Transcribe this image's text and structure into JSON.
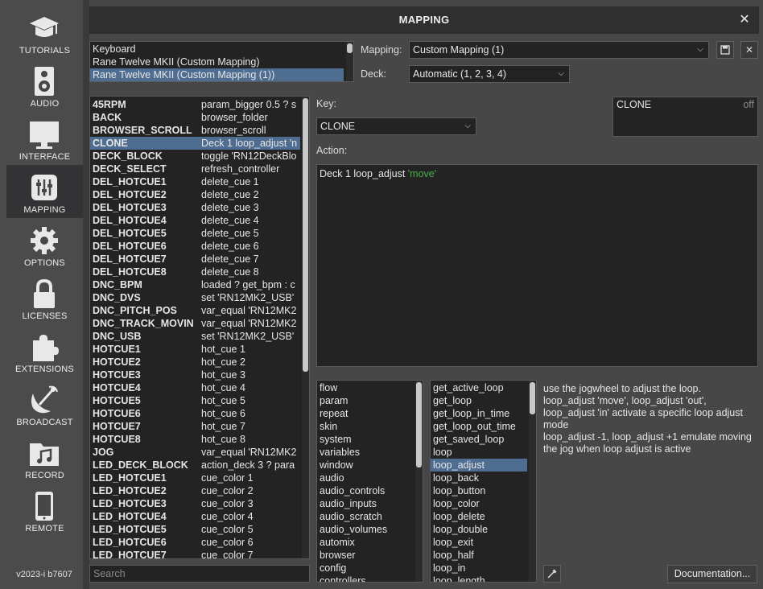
{
  "sidebar": {
    "items": [
      {
        "label": "TUTORIALS",
        "icon": "graduation-cap-icon"
      },
      {
        "label": "AUDIO",
        "icon": "speaker-icon"
      },
      {
        "label": "INTERFACE",
        "icon": "monitor-icon"
      },
      {
        "label": "MAPPING",
        "icon": "sliders-icon",
        "active": true
      },
      {
        "label": "OPTIONS",
        "icon": "gear-icon"
      },
      {
        "label": "LICENSES",
        "icon": "lock-icon"
      },
      {
        "label": "EXTENSIONS",
        "icon": "puzzle-icon"
      },
      {
        "label": "BROADCAST",
        "icon": "satellite-dish-icon"
      },
      {
        "label": "RECORD",
        "icon": "music-folder-icon"
      },
      {
        "label": "REMOTE",
        "icon": "phone-icon"
      }
    ],
    "version": "v2023-i b7607"
  },
  "window": {
    "title": "MAPPING",
    "close": "✕"
  },
  "controllers": {
    "items": [
      "Keyboard",
      "Rane Twelve MKII (Custom Mapping)",
      "Rane Twelve MKII (Custom Mapping (1))"
    ],
    "selected_index": 2
  },
  "mapping": {
    "label": "Mapping:",
    "value": "Custom Mapping (1)"
  },
  "deck": {
    "label": "Deck:",
    "value": "Automatic (1, 2, 3, 4)"
  },
  "key": {
    "label": "Key:",
    "value": "CLONE"
  },
  "action": {
    "label": "Action:",
    "text": "Deck 1 loop_adjust ",
    "arg": "'move'"
  },
  "clone_box": {
    "name": "CLONE",
    "state": "off"
  },
  "map_table": {
    "selected_index": 3,
    "rows": [
      [
        "45RPM",
        "param_bigger 0.5 ? s"
      ],
      [
        "BACK",
        "browser_folder"
      ],
      [
        "BROWSER_SCROLL",
        "browser_scroll"
      ],
      [
        "CLONE",
        "Deck 1 loop_adjust 'n"
      ],
      [
        "DECK_BLOCK",
        "toggle 'RN12DeckBlo"
      ],
      [
        "DECK_SELECT",
        "refresh_controller"
      ],
      [
        "DEL_HOTCUE1",
        "delete_cue 1"
      ],
      [
        "DEL_HOTCUE2",
        "delete_cue 2"
      ],
      [
        "DEL_HOTCUE3",
        "delete_cue 3"
      ],
      [
        "DEL_HOTCUE4",
        "delete_cue 4"
      ],
      [
        "DEL_HOTCUE5",
        "delete_cue 5"
      ],
      [
        "DEL_HOTCUE6",
        "delete_cue 6"
      ],
      [
        "DEL_HOTCUE7",
        "delete_cue 7"
      ],
      [
        "DEL_HOTCUE8",
        "delete_cue 8"
      ],
      [
        "DNC_BPM",
        "loaded ? get_bpm : c"
      ],
      [
        "DNC_DVS",
        "set 'RN12MK2_USB'"
      ],
      [
        "DNC_PITCH_POS",
        "var_equal 'RN12MK2"
      ],
      [
        "DNC_TRACK_MOVIN",
        "var_equal 'RN12MK2"
      ],
      [
        "DNC_USB",
        "set 'RN12MK2_USB'"
      ],
      [
        "HOTCUE1",
        "hot_cue 1"
      ],
      [
        "HOTCUE2",
        "hot_cue 2"
      ],
      [
        "HOTCUE3",
        "hot_cue 3"
      ],
      [
        "HOTCUE4",
        "hot_cue 4"
      ],
      [
        "HOTCUE5",
        "hot_cue 5"
      ],
      [
        "HOTCUE6",
        "hot_cue 6"
      ],
      [
        "HOTCUE7",
        "hot_cue 7"
      ],
      [
        "HOTCUE8",
        "hot_cue 8"
      ],
      [
        "JOG",
        "var_equal 'RN12MK2"
      ],
      [
        "LED_DECK_BLOCK",
        "action_deck 3 ? para"
      ],
      [
        "LED_HOTCUE1",
        "cue_color 1"
      ],
      [
        "LED_HOTCUE2",
        "cue_color 2"
      ],
      [
        "LED_HOTCUE3",
        "cue_color 3"
      ],
      [
        "LED_HOTCUE4",
        "cue_color 4"
      ],
      [
        "LED_HOTCUE5",
        "cue_color 5"
      ],
      [
        "LED_HOTCUE6",
        "cue_color 6"
      ],
      [
        "LED_HOTCUE7",
        "cue_color 7"
      ]
    ]
  },
  "categories": [
    "flow",
    "param",
    "repeat",
    "skin",
    "system",
    "variables",
    "window",
    "audio",
    "audio_controls",
    "audio_inputs",
    "audio_scratch",
    "audio_volumes",
    "automix",
    "browser",
    "config",
    "controllers"
  ],
  "verbs": {
    "selected_index": 6,
    "items": [
      "get_active_loop",
      "get_loop",
      "get_loop_in_time",
      "get_loop_out_time",
      "get_saved_loop",
      "loop",
      "loop_adjust",
      "loop_back",
      "loop_button",
      "loop_color",
      "loop_delete",
      "loop_double",
      "loop_exit",
      "loop_half",
      "loop_in",
      "loop_length"
    ]
  },
  "help": "use the jogwheel to adjust the loop.\nloop_adjust 'move', loop_adjust 'out', loop_adjust 'in' activate a specific loop adjust mode\nloop_adjust -1, loop_adjust +1 emulate moving the jog when loop adjust is active",
  "search": {
    "placeholder": "Search"
  },
  "documentation": "Documentation..."
}
